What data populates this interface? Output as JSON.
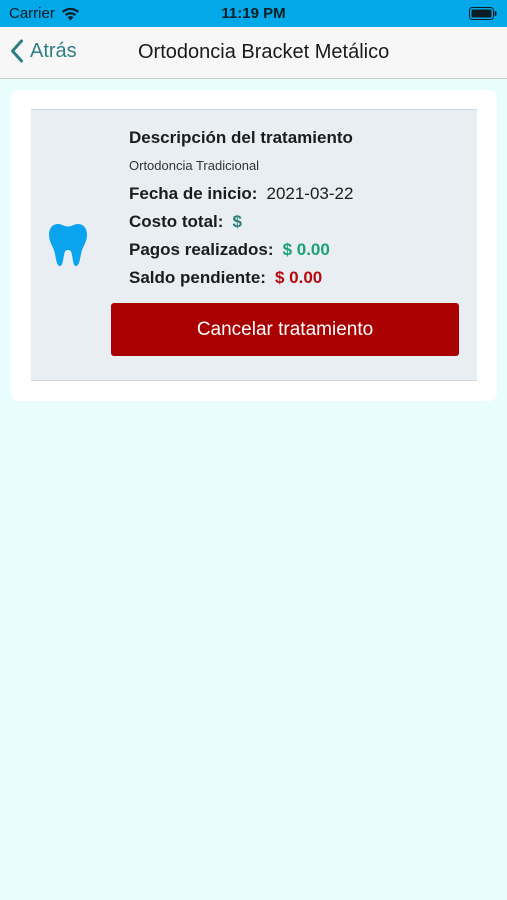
{
  "status_bar": {
    "carrier": "Carrier",
    "time": "11:19 PM",
    "icons": [
      "wifi-icon",
      "battery-icon"
    ]
  },
  "nav": {
    "back_label": "Atrás",
    "title": "Ortodoncia Bracket Metálico",
    "icons": [
      "chevron-left-icon"
    ]
  },
  "treatment": {
    "icon": "tooth-icon",
    "description_title": "Descripción del tratamiento",
    "description_value": "Ortodoncia Tradicional",
    "start_date_label": "Fecha de inicio:",
    "start_date_value": "2021-03-22",
    "total_cost_label": "Costo total:",
    "total_cost_value": "$",
    "payments_label": "Pagos realizados:",
    "payments_value": "$ 0.00",
    "balance_label": "Saldo pendiente:",
    "balance_value": "$ 0.00",
    "cancel_label": "Cancelar tratamiento"
  },
  "colors": {
    "status_bar": "#03a8e8",
    "background": "#eafdfe",
    "accent": "#2e7e84",
    "tooth": "#0aa3ee",
    "paid": "#1aa074",
    "balance": "#b50a10",
    "cancel_button": "#a90002"
  }
}
